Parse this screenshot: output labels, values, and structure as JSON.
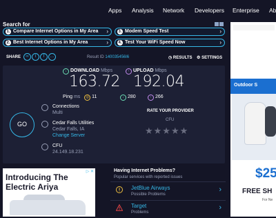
{
  "nav": {
    "items": [
      "Apps",
      "Analysis",
      "Network",
      "Developers",
      "Enterprise",
      "Ab"
    ]
  },
  "search": {
    "title": "Search for",
    "options": [
      {
        "num": "1.",
        "label": "Compare Internet Options in My Area"
      },
      {
        "num": "3.",
        "label": "Modem Speed Test"
      },
      {
        "num": "2.",
        "label": "Best Internet Options in My Area"
      },
      {
        "num": "4.",
        "label": "Test Your WiFi Speed Now"
      }
    ]
  },
  "toolbar": {
    "share_label": "SHARE",
    "result_id_label": "Result ID",
    "result_id": "140035456l6",
    "results_label": "RESULTS",
    "settings_label": "SETTINGS"
  },
  "speed": {
    "download_label": "DOWNLOAD",
    "download_unit": "Mbps",
    "download_value": "163.72",
    "upload_label": "UPLOAD",
    "upload_unit": "Mbps",
    "upload_value": "192.04",
    "ping_label": "Ping",
    "ping_unit": "ms",
    "ping_value": "11",
    "download_latency": "280",
    "upload_latency": "266"
  },
  "go_label": "GO",
  "connections": {
    "title": "Connections",
    "value": "Multi"
  },
  "provider": {
    "name": "Cedar Falls Utilities",
    "location": "Cedar Falls, IA",
    "change_link": "Change Server"
  },
  "isp": {
    "name": "CFU",
    "ip": "24.149.18.231"
  },
  "rate": {
    "title": "RATE YOUR PROVIDER",
    "provider": "CFU",
    "stars": "★★★★★"
  },
  "ad_left": {
    "line1": "Introducing The",
    "line2": "Electric Ariya"
  },
  "problems": {
    "title": "Having Internet Problems?",
    "subtitle": "Popular services with reported issues",
    "items": [
      {
        "name": "JetBlue Airways",
        "status": "Possible Problems"
      },
      {
        "name": "Target",
        "status": "Problems"
      }
    ]
  },
  "ad_right": {
    "headline": "Outdoor S",
    "price": "$25",
    "free": "FREE SH",
    "fine": "For Ne"
  },
  "colors": {
    "accent": "#36b8e8",
    "download": "#6ce0b5",
    "upload": "#c48cf0",
    "ping": "#f0c040",
    "warning": "#f0c040",
    "danger": "#e64545",
    "background": "#141526",
    "panel": "#1d2035"
  }
}
